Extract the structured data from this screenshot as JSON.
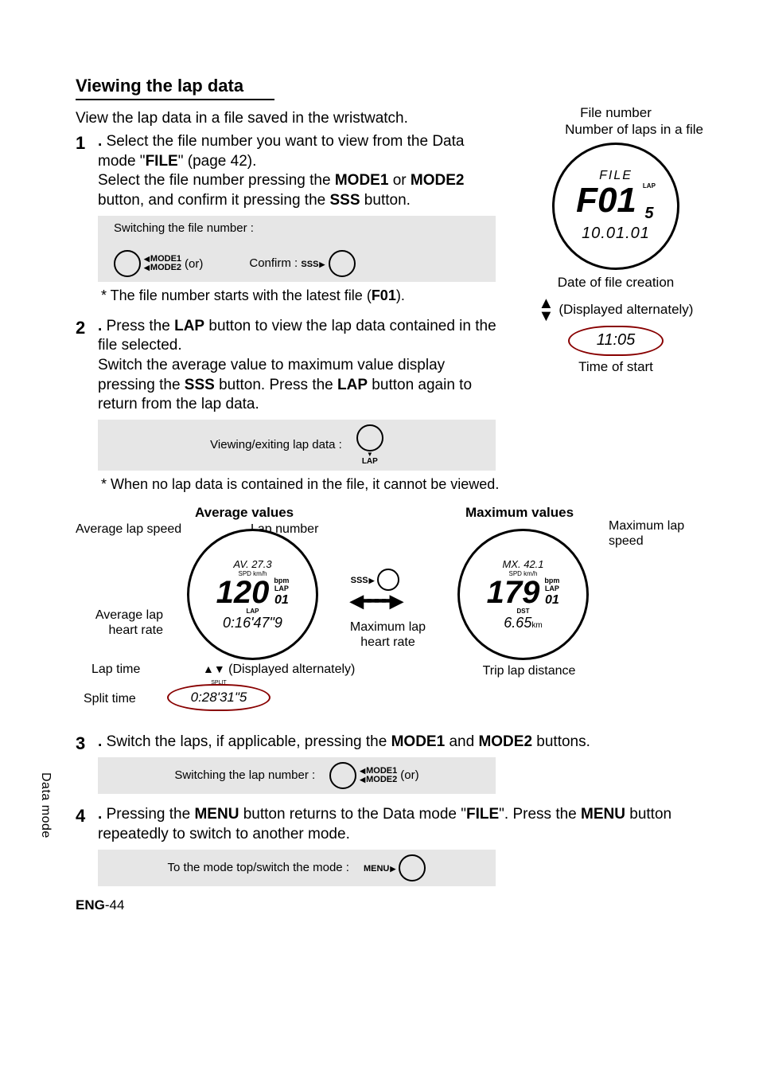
{
  "sideTab": "Data mode",
  "sectionTitle": "Viewing the lap data",
  "intro": "View the lap data in a file saved in the wristwatch.",
  "step1": {
    "num": "1",
    "text_a": "Select the file number you want to view from the Data mode \"",
    "file": "FILE",
    "text_b": "\" (page 42).",
    "text_c": "Select the file number pressing the ",
    "mode1": "MODE1",
    "or": " or ",
    "mode2": "MODE2",
    "text_d": " button, and confirm it pressing the ",
    "sss": "SSS",
    "text_e": " button.",
    "box_label": "Switching the file number :",
    "box_mode1": "MODE1",
    "box_mode2": "MODE2",
    "box_or": "(or)",
    "box_confirm": "Confirm :",
    "box_sss": "SSS",
    "note": "* The file number starts with the latest file (",
    "note_b": "F01",
    "note_c": ")."
  },
  "step2": {
    "num": "2",
    "text_a": "Press the ",
    "lap": "LAP",
    "text_b": " button to view the lap data contained in the file selected.",
    "text_c": "Switch the average value to maximum value display pressing the ",
    "sss": "SSS",
    "text_d": " button. Press the ",
    "lap2": "LAP",
    "text_e": " button again to return from the lap data.",
    "box_label": "Viewing/exiting lap data :",
    "box_lap": "LAP",
    "note": "* When no lap data is contained in the file, it cannot be viewed."
  },
  "rightDiagram": {
    "fileNumber": "File number",
    "lapsInFile": "Number of laps in a file",
    "watch_row1": "FILE",
    "watch_row2_main": "F01",
    "watch_row2_laplbl": "LAP",
    "watch_row2_lapnum": "5",
    "watch_row3": "10.01.01",
    "dateCaption": "Date of file creation",
    "displayedAlt": "(Displayed alternately)",
    "timeValue": "11:05",
    "timeCaption": "Time of start"
  },
  "diagram": {
    "avgTitle": "Average values",
    "maxTitle": "Maximum values",
    "avgLapSpeed": "Average lap speed",
    "lapNumber": "Lap number",
    "maxLapSpeed": "Maximum lap speed",
    "avgHR": "Average lap heart rate",
    "maxHR": "Maximum lap heart rate",
    "lapTime": "Lap time",
    "splitTime": "Split time",
    "tripDist": "Trip lap distance",
    "dispAlt": "(Displayed alternately)",
    "sss": "SSS",
    "watchL": {
      "top": "AV.  27.3",
      "sub": "SPD km/h",
      "big": "120",
      "side_top": "bpm",
      "side_lap": "LAP",
      "side_num": "01",
      "mid": "LAP",
      "bot": "0:16'47\"9"
    },
    "watchR": {
      "top": "MX.  42.1",
      "sub": "SPD km/h",
      "big": "179",
      "side_top": "bpm",
      "side_lap": "LAP",
      "side_num": "01",
      "mid": "DST",
      "bot": "6.65",
      "botunit": "km"
    },
    "splitVal": "0:28'31\"5",
    "splitLbl": "SPLIT"
  },
  "step3": {
    "num": "3",
    "text_a": "Switch the laps, if applicable, pressing the ",
    "mode1": "MODE1",
    "and": " and ",
    "mode2": "MODE2",
    "text_b": " buttons.",
    "box_label": "Switching the lap number :",
    "box_mode1": "MODE1",
    "box_mode2": "MODE2",
    "box_or": "(or)"
  },
  "step4": {
    "num": "4",
    "text_a": "Pressing the ",
    "menu": "MENU",
    "text_b": " button returns to the Data mode \"",
    "file": "FILE",
    "text_c": "\". Press the ",
    "menu2": "MENU",
    "text_d": " button repeatedly to switch to another mode.",
    "box_label": "To the mode top/switch the mode :",
    "box_menu": "MENU"
  },
  "footer": {
    "lang": "ENG",
    "page": "-44"
  }
}
